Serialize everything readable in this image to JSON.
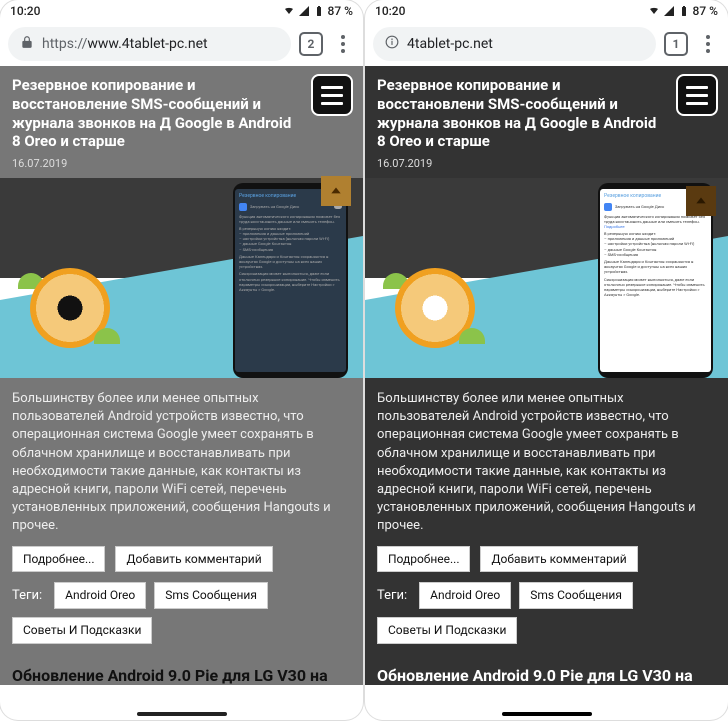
{
  "status": {
    "time": "10:20",
    "battery_pct": "87 %"
  },
  "left": {
    "url_scheme": "https://",
    "url_rest": "www.4tablet-pc.net",
    "tab_count": "2",
    "headline": "Резервное копирование и восстановление SMS-сообщений и журнала звонков на Д Google в Android 8 Oreo и старше",
    "date": "16.07.2019",
    "body": "Большинству более или менее опытных пользователей Android устройств известно, что операционная система Google умеет сохранять в облачном хранилище и восстанавливать при необходимости такие данные, как контакты из адресной книги, пароли WiFi сетей, перечень установленных приложений, сообщения Hangouts и прочее.",
    "btn_more": "Подробнее...",
    "btn_comment": "Добавить комментарий",
    "tags_label": "Теги:",
    "tags": [
      "Android Oreo",
      "Sms Сообщения",
      "Советы И Подсказки"
    ],
    "next_headline": "Обновление Android 9.0 Pie для LG V30 на",
    "hero_backup_title": "Резервное копирование",
    "hero_drive_label": "Загружать на Google Диск"
  },
  "right": {
    "url": "4tablet-pc.net",
    "tab_count": "1",
    "headline": "Резервное копирование и восстановлени SMS-сообщений и журнала звонков на Д Google в Android 8 Oreo и старше",
    "date": "16.07.2019",
    "body": "Большинству более или менее опытных пользователей Android устройств известно, что операционная система Google умеет сохранять в облачном хранилище и восстанавливать при необходимости такие данные, как контакты из адресной книги, пароли WiFi сетей, перечень установленных приложений, сообщения Hangouts и прочее.",
    "btn_more": "Подробнее...",
    "btn_comment": "Добавить комментарий",
    "tags_label": "Теги:",
    "tags": [
      "Android Oreo",
      "Sms Сообщения",
      "Советы И Подсказки"
    ],
    "next_headline": "Обновление Android 9.0 Pie для LG V30 на",
    "hero_backup_title": "Резервное копирование",
    "hero_drive_label": "Загружать на Google Диск"
  }
}
